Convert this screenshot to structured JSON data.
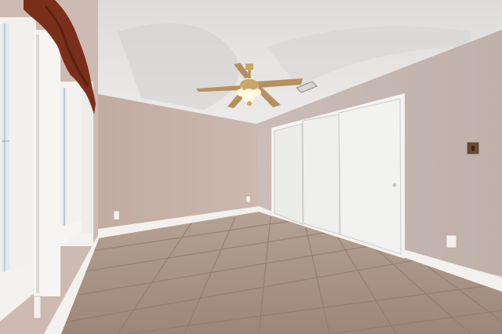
{
  "scene": {
    "description_tag": "empty-bedroom-photo",
    "colors": {
      "ceiling": "#e9e8e6",
      "back_wall": "#c9b5ab",
      "right_wall": "#c6b8b3",
      "left_wall": "#cdbab2",
      "floor_tile": "#a89384",
      "floor_grout": "#8e7b6e",
      "trim": "#f3f1ee",
      "closet_door": "#eeeeed",
      "curtain": "#7a2f1a",
      "fan_blade": "#b7905f",
      "fan_brass": "#c9a866",
      "fan_light": "#fff9e6",
      "window_glass": "#e6ecef"
    }
  }
}
